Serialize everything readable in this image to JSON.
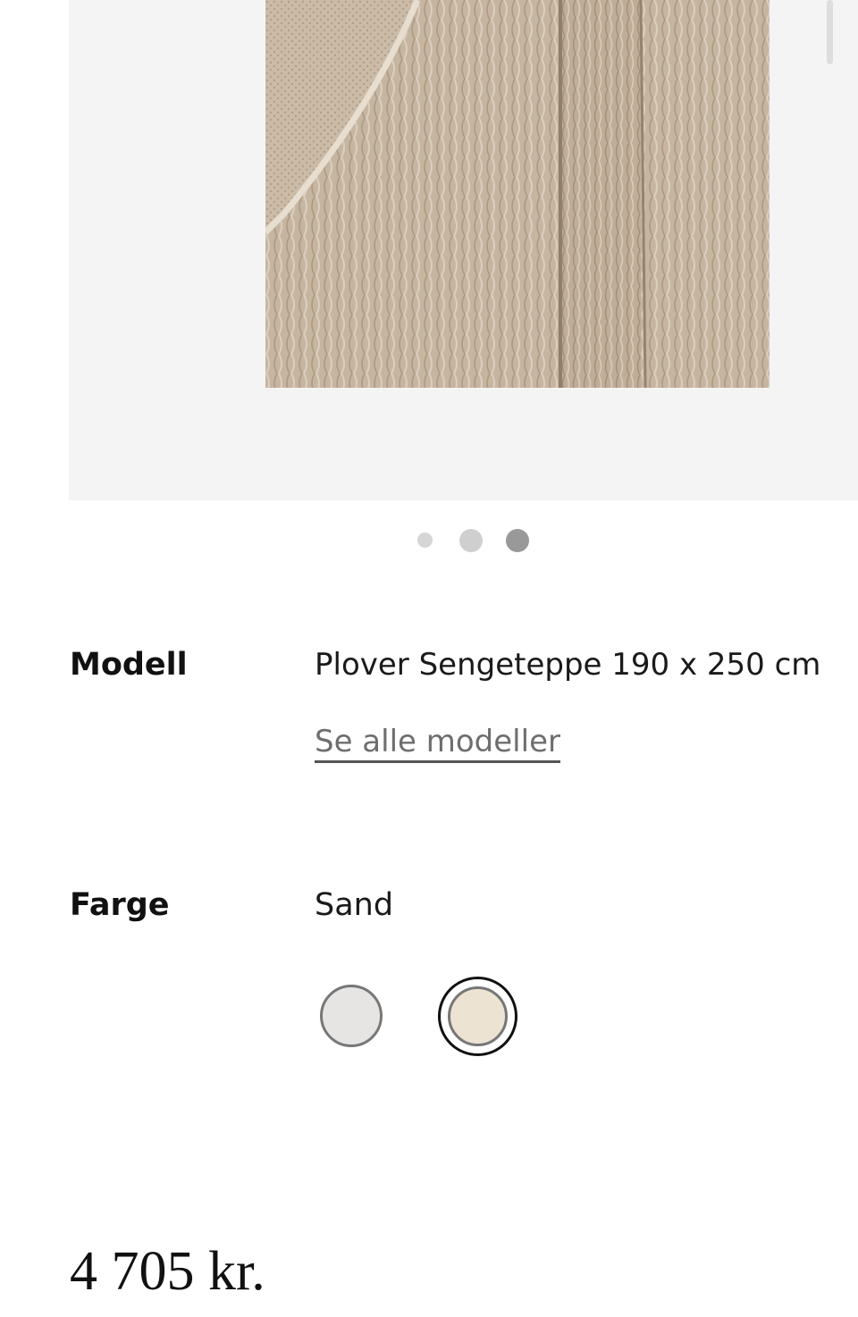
{
  "gallery": {
    "image_description_icon": "knitted-blanket-image",
    "dots": [
      {
        "active": false
      },
      {
        "active": false
      },
      {
        "active": true
      }
    ]
  },
  "model": {
    "label": "Modell",
    "value": "Plover Sengeteppe 190 x 250 cm",
    "link": "Se alle modeller"
  },
  "color": {
    "label": "Farge",
    "value": "Sand",
    "swatches": [
      {
        "name": "grey",
        "hex": "#e6e5e3",
        "selected": false
      },
      {
        "name": "sand",
        "hex": "#ece3d2",
        "selected": true
      }
    ]
  },
  "price": "4 705 kr."
}
